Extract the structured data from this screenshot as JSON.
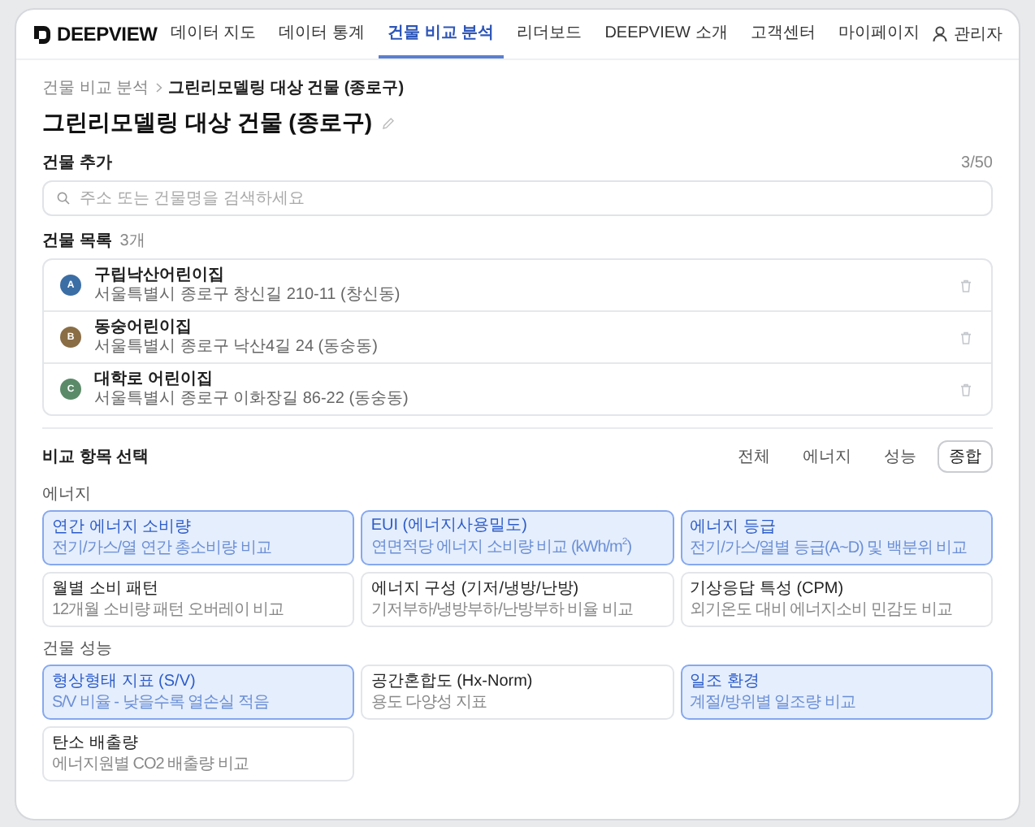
{
  "nav": {
    "logo": "DEEPVIEW",
    "items": [
      {
        "label": "데이터 지도",
        "selected": false
      },
      {
        "label": "데이터 통계",
        "selected": false
      },
      {
        "label": "건물 비교 분석",
        "selected": true
      },
      {
        "label": "리더보드",
        "selected": false
      },
      {
        "label": "DEEPVIEW 소개",
        "selected": false
      },
      {
        "label": "고객센터",
        "selected": false
      },
      {
        "label": "마이페이지",
        "selected": false
      }
    ],
    "user": "관리자"
  },
  "breadcrumb": [
    "건물 비교 분석",
    "그린리모델링 대상 건물 (종로구)"
  ],
  "title": "그린리모델링 대상 건물 (종로구)",
  "add": {
    "heading": "건물 추가",
    "count": "3/50",
    "placeholder": "주소 또는 건물명을 검색하세요"
  },
  "list": {
    "heading": "건물 목록",
    "count": "3개",
    "buildings": [
      {
        "badge": "A",
        "name": "구립낙산어린이집",
        "address": "서울특별시 종로구 창신길 210-11 (창신동)",
        "color": "#3b6ea5"
      },
      {
        "badge": "B",
        "name": "동숭어린이집",
        "address": "서울특별시 종로구 낙산4길 24 (동숭동)",
        "color": "#8a6d45"
      },
      {
        "badge": "C",
        "name": "대학로 어린이집",
        "address": "서울특별시 종로구 이화장길 86-22 (동숭동)",
        "color": "#5b8a68"
      }
    ]
  },
  "compare": {
    "heading": "비교 항목 선택",
    "filters": [
      {
        "label": "전체",
        "selected": false
      },
      {
        "label": "에너지",
        "selected": false
      },
      {
        "label": "성능",
        "selected": false
      },
      {
        "label": "종합",
        "selected": true
      }
    ],
    "groups": [
      {
        "label": "에너지",
        "items": [
          {
            "title": "연간 에너지 소비량",
            "desc": "전기/가스/열 연간 총소비량 비교",
            "selected": true
          },
          {
            "title": "EUI (에너지사용밀도)",
            "desc": "연면적당 에너지 소비량 비교 (kWh/m$^{2}$)",
            "selected": true
          },
          {
            "title": "에너지 등급",
            "desc": "전기/가스/열별 등급(A~D) 및 백분위 비교",
            "selected": true
          },
          {
            "title": "월별 소비 패턴",
            "desc": "12개월 소비량 패턴 오버레이 비교",
            "selected": false
          },
          {
            "title": "에너지 구성 (기저/냉방/난방)",
            "desc": "기저부하/냉방부하/난방부하 비율 비교",
            "selected": false
          },
          {
            "title": "기상응답 특성 (CPM)",
            "desc": "외기온도 대비 에너지소비 민감도 비교",
            "selected": false
          }
        ]
      },
      {
        "label": "건물 성능",
        "items": [
          {
            "title": "형상형태 지표 (S/V)",
            "desc": "S/V 비율 - 낮을수록 열손실 적음",
            "selected": true
          },
          {
            "title": "공간혼합도 (Hx-Norm)",
            "desc": "용도 다양성 지표",
            "selected": false
          },
          {
            "title": "일조 환경",
            "desc": "계절/방위별 일조량 비교",
            "selected": true
          },
          {
            "title": "탄소 배출량",
            "desc": "에너지원별 CO2 배출량 비교",
            "selected": false
          }
        ]
      }
    ]
  }
}
